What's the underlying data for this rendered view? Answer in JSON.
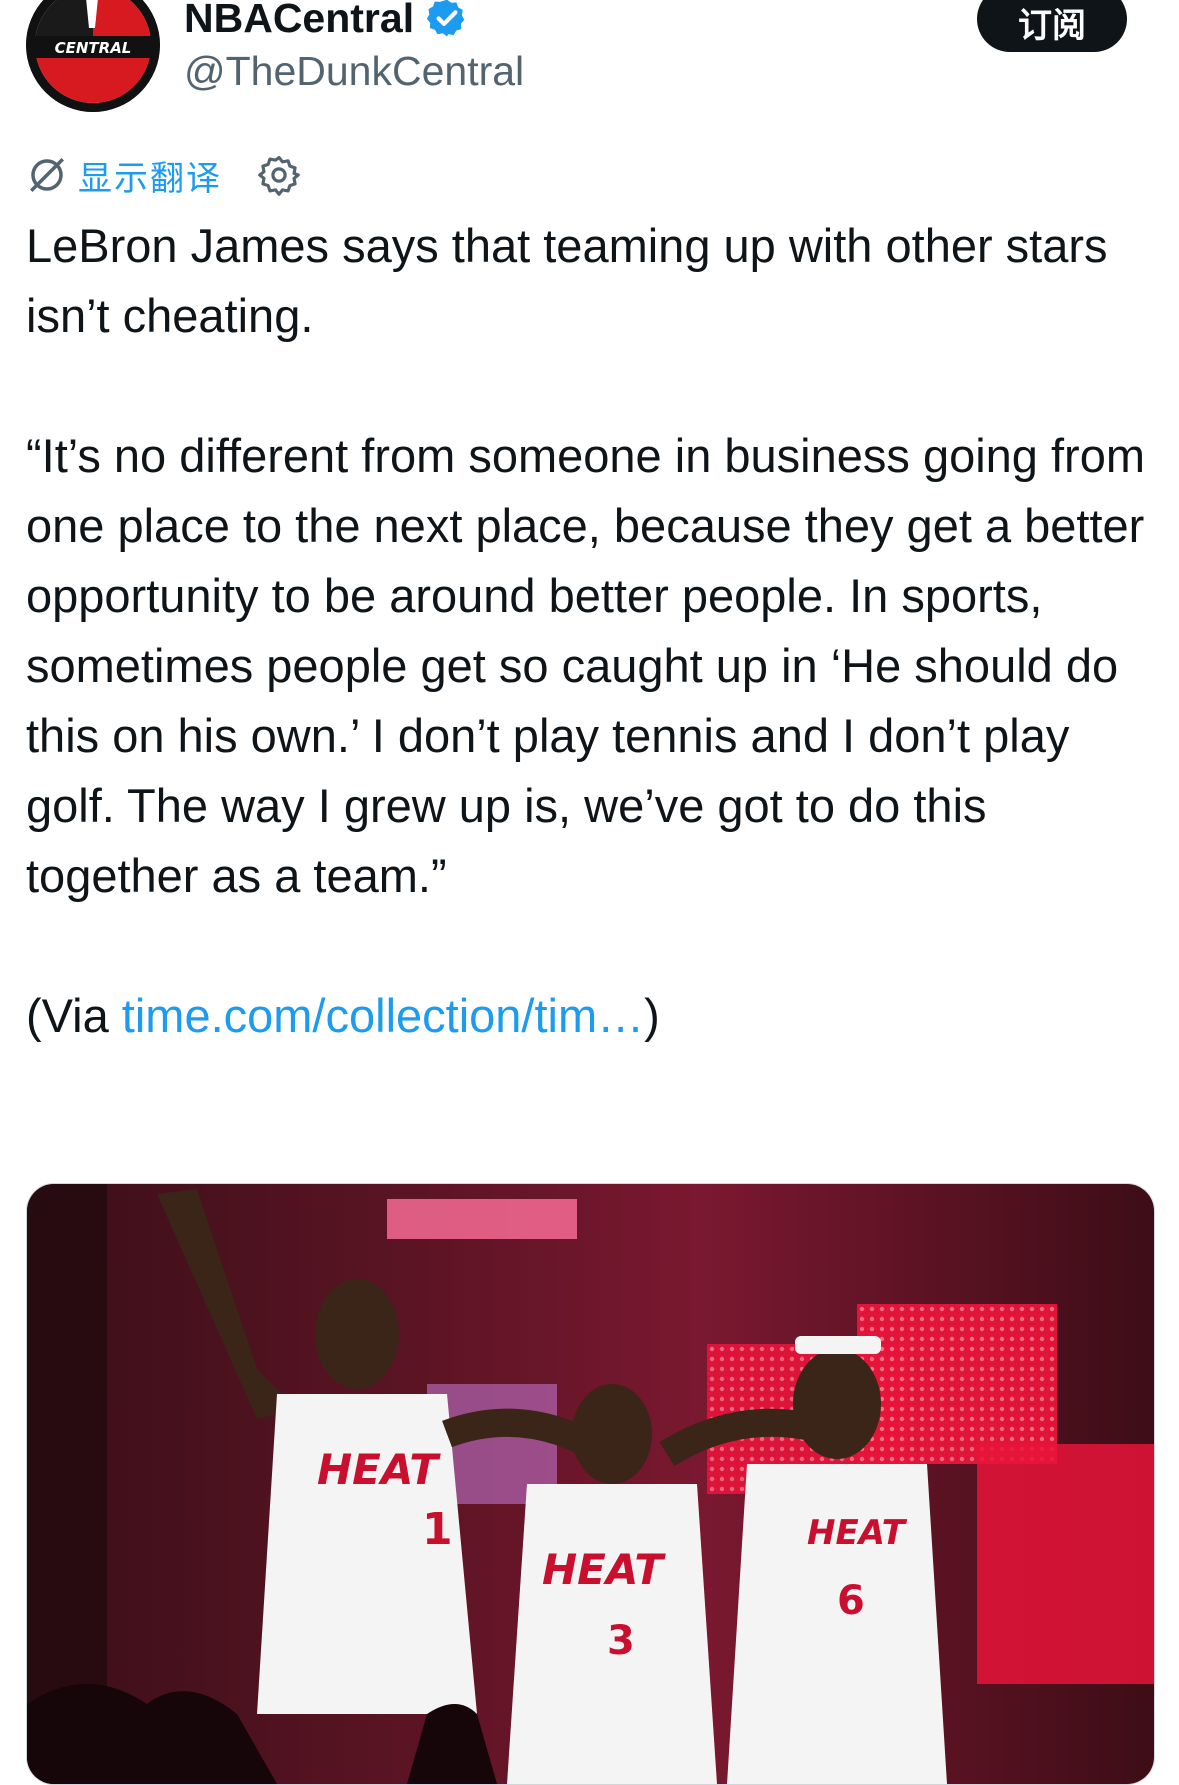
{
  "account": {
    "display_name": "NBACentral",
    "handle": "@TheDunkCentral",
    "avatar_text": "CENTRAL",
    "verified": true,
    "subscribe_label": "订阅"
  },
  "translate": {
    "label": "显示翻译",
    "icon": "translate-slash-icon",
    "settings_icon": "gear-icon"
  },
  "tweet": {
    "line1": "LeBron James says that teaming up with other stars isn’t cheating.",
    "quote": "“It’s no different from someone in business going from one place to the next place, because they get a better opportunity to be around better people. In sports, sometimes people get so caught up in ‘He should do this on his own.’ I don’t play tennis and I don’t play golf. The way I grew up is, we’ve got to do this together as a team.”",
    "via_prefix": "(Via ",
    "via_link": "time.com/collection/tim…",
    "via_suffix": ")"
  },
  "media": {
    "jersey_text": "HEAT",
    "numbers": [
      "1",
      "3",
      "6"
    ]
  },
  "colors": {
    "accent": "#1d9bf0",
    "text": "#0f1419",
    "secondary": "#536471",
    "stage_red": "#e8143a",
    "background": "#ffffff"
  }
}
